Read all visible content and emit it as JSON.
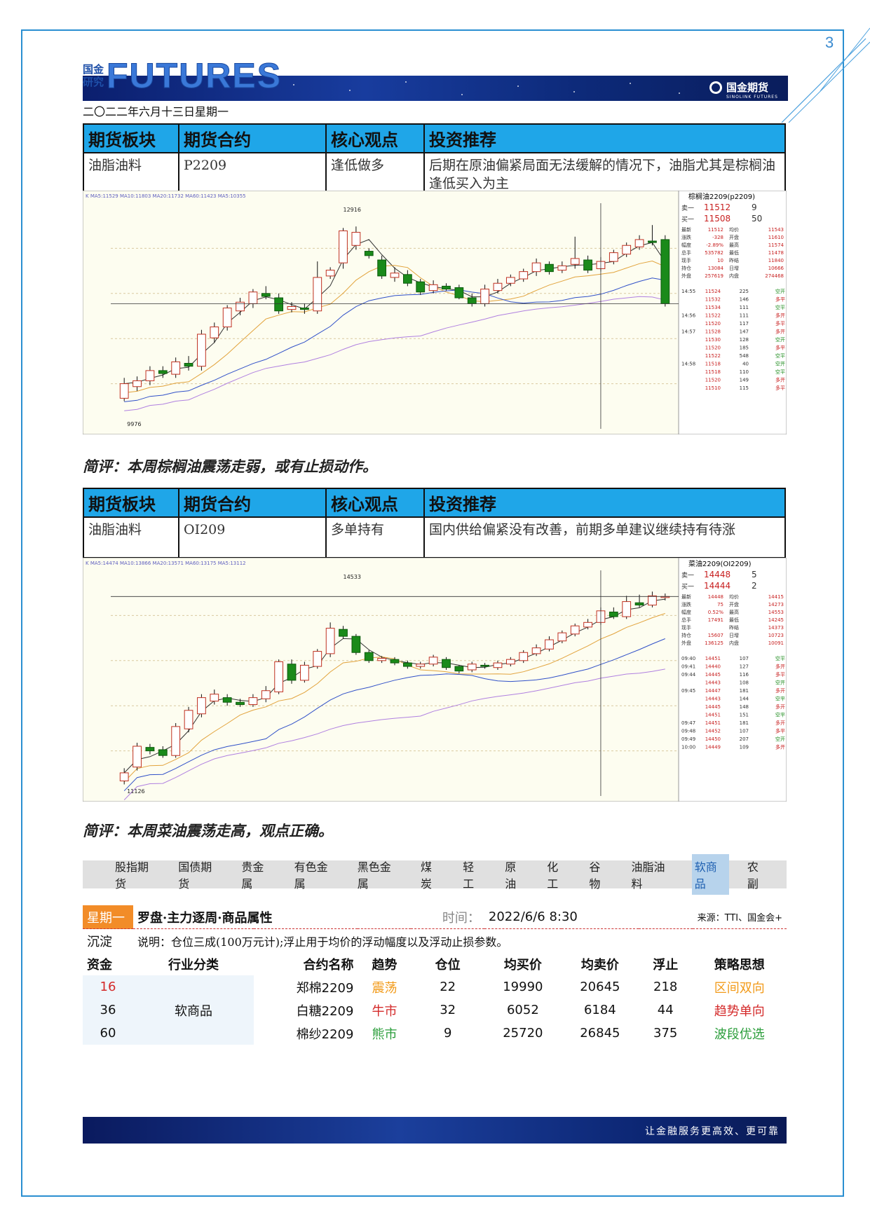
{
  "page_number": "3",
  "header": {
    "logo_cn_top": "国金",
    "logo_cn_bottom": "研究",
    "logo_en": "FUTURES",
    "brand_name": "国金期货",
    "brand_en": "SINOLINK FUTURES",
    "date": "二〇二二年六月十三日星期一"
  },
  "table_headers": [
    "期货板块",
    "期货合约",
    "核心观点",
    "投资推荐"
  ],
  "block1": {
    "sector": "油脂油料",
    "contract": "P2209",
    "view": "逢低做多",
    "recommendation": "后期在原油偏紧局面无法缓解的情况下，油脂尤其是棕榈油逢低买入为主",
    "comment": "简评：本周棕榈油震荡走弱，或有止损动作。"
  },
  "chart1": {
    "title": "棕榈油2209(p2209)",
    "ma_line": "K MA5:11529 MA10:11803 MA20:11732 MA60:11423 MA5:10355",
    "high_label": "12916",
    "low_label": "9976",
    "ask_label": "卖一",
    "ask_price": "11512",
    "ask_vol": "9",
    "bid_label": "买一",
    "bid_price": "11508",
    "bid_vol": "50",
    "stats": [
      [
        "最新",
        "11512",
        "均价",
        "11543"
      ],
      [
        "涨跌",
        "-328",
        "开盘",
        "11610"
      ],
      [
        "幅度",
        "-2.89%",
        "最高",
        "11574"
      ],
      [
        "总手",
        "535782",
        "最低",
        "11478"
      ],
      [
        "现手",
        "10",
        "昨结",
        "11840"
      ],
      [
        "持仓",
        "13084",
        "日增",
        "10666"
      ],
      [
        "外盘",
        "257619",
        "内盘",
        "274468"
      ]
    ],
    "ticks": [
      [
        "14:55",
        "11524",
        "225",
        "空开"
      ],
      [
        "",
        "11532",
        "146",
        "多平"
      ],
      [
        "",
        "11534",
        "111",
        "空平"
      ],
      [
        "14:56",
        "11522",
        "111",
        "多开"
      ],
      [
        "",
        "11520",
        "117",
        "多平"
      ],
      [
        "14:57",
        "11528",
        "147",
        "多开"
      ],
      [
        "",
        "11530",
        "128",
        "空开"
      ],
      [
        "",
        "11520",
        "185",
        "多平"
      ],
      [
        "",
        "11522",
        "548",
        "空平"
      ],
      [
        "14:58",
        "11518",
        "40",
        "空开"
      ],
      [
        "",
        "11518",
        "110",
        "空平"
      ],
      [
        "",
        "11520",
        "149",
        "多开"
      ],
      [
        "",
        "11510",
        "115",
        "多平"
      ]
    ]
  },
  "block2": {
    "sector": "油脂油料",
    "contract": "OI209",
    "view": "多单持有",
    "recommendation": "国内供给偏紧没有改善，前期多单建议继续持有待涨",
    "comment": "简评：本周菜油震荡走高，观点正确。"
  },
  "chart2": {
    "title": "菜油2209(OI2209)",
    "ma_line": "K MA5:14474 MA10:13866 MA20:13571 MA60:13175 MA5:13112",
    "high_label": "14533",
    "low_label": "11126",
    "ask_label": "卖一",
    "ask_price": "14448",
    "ask_vol": "5",
    "bid_label": "买一",
    "bid_price": "14444",
    "bid_vol": "2",
    "stats": [
      [
        "最新",
        "14448",
        "均价",
        "14415"
      ],
      [
        "涨跌",
        "75",
        "开盘",
        "14273"
      ],
      [
        "幅度",
        "0.52%",
        "最高",
        "14553"
      ],
      [
        "总手",
        "17491",
        "最低",
        "14245"
      ],
      [
        "现手",
        "",
        "昨结",
        "14373"
      ],
      [
        "持仓",
        "15607",
        "日增",
        "10723"
      ],
      [
        "外盘",
        "136125",
        "内盘",
        "10091"
      ]
    ],
    "ticks": [
      [
        "09:40",
        "14451",
        "107",
        "空平"
      ],
      [
        "09:41",
        "14440",
        "127",
        "多开"
      ],
      [
        "09:44",
        "14445",
        "116",
        "多平"
      ],
      [
        "",
        "14443",
        "108",
        "空开"
      ],
      [
        "09:45",
        "14447",
        "181",
        "多开"
      ],
      [
        "",
        "14443",
        "144",
        "空平"
      ],
      [
        "",
        "14445",
        "148",
        "多开"
      ],
      [
        "",
        "14451",
        "151",
        "空平"
      ],
      [
        "09:47",
        "14451",
        "181",
        "多开"
      ],
      [
        "09:48",
        "14452",
        "107",
        "多平"
      ],
      [
        "09:49",
        "14450",
        "207",
        "空开"
      ],
      [
        "10:00",
        "14449",
        "109",
        "多开"
      ]
    ]
  },
  "nav_tabs": [
    "股指期货",
    "国债期货",
    "贵金属",
    "有色金属",
    "黑色金属",
    "煤炭",
    "轻工",
    "原油",
    "化工",
    "谷物",
    "油脂油料",
    "软商品",
    "农副"
  ],
  "nav_active": "软商品",
  "positions": {
    "day": "星期一",
    "title": "罗盘·主力逐周·商品属性",
    "time_label": "时间：",
    "time_value": "2022/6/6 8:30",
    "source": "来源：TTI、国金会+",
    "left_labels": [
      "沉淀",
      "资金"
    ],
    "note": "说明：仓位三成(100万元计);浮止用于均价的浮动幅度以及浮动止损参数。",
    "columns": [
      "行业分类",
      "合约名称",
      "趋势",
      "仓位",
      "均买价",
      "均卖价",
      "浮止",
      "策略思想"
    ],
    "industry": "软商品",
    "rows": [
      {
        "fund": "16",
        "contract": "郑棉2209",
        "trend": "震荡",
        "position": "22",
        "buy": "19990",
        "sell": "20645",
        "float_stop": "218",
        "strategy": "区间双向"
      },
      {
        "fund": "36",
        "contract": "白糖2209",
        "trend": "牛市",
        "position": "32",
        "buy": "6052",
        "sell": "6184",
        "float_stop": "44",
        "strategy": "趋势单向"
      },
      {
        "fund": "60",
        "contract": "棉纱2209",
        "trend": "熊市",
        "position": "9",
        "buy": "25720",
        "sell": "26845",
        "float_stop": "375",
        "strategy": "波段优选"
      }
    ]
  },
  "footer_text": "让金融服务更高效、更可靠",
  "colors": {
    "frame": "#2a8fd1",
    "table_header": "#1fa6e8",
    "up_candle": "#1a8a1a",
    "red": "#d42a2a",
    "green": "#2a9d3a",
    "orange": "#f29a19"
  },
  "chart_data": [
    {
      "type": "candlestick",
      "title": "棕榈油2209(p2209)",
      "ylim": [
        9900,
        13000
      ],
      "candles": [
        [
          10320,
          10520,
          10280,
          10600
        ],
        [
          10480,
          10560,
          10420,
          10620
        ],
        [
          10560,
          10700,
          10500,
          10760
        ],
        [
          10700,
          10660,
          10600,
          10760
        ],
        [
          10650,
          10820,
          10600,
          10880
        ],
        [
          10800,
          10760,
          10700,
          10900
        ],
        [
          10760,
          11200,
          10700,
          11260
        ],
        [
          11150,
          11300,
          11080,
          11360
        ],
        [
          11300,
          11560,
          11250,
          11600
        ],
        [
          11520,
          11640,
          11460,
          11700
        ],
        [
          11620,
          11780,
          11560,
          11820
        ],
        [
          11760,
          11720,
          11680,
          11860
        ],
        [
          11700,
          11520,
          11480,
          11760
        ],
        [
          11540,
          11580,
          11500,
          11640
        ],
        [
          11560,
          11540,
          11480,
          11620
        ],
        [
          11520,
          11980,
          11480,
          12200
        ],
        [
          12000,
          12080,
          11960,
          12120
        ],
        [
          12180,
          12620,
          12100,
          12660
        ],
        [
          12420,
          12600,
          12360,
          12680
        ],
        [
          12340,
          12280,
          12240,
          12380
        ],
        [
          12220,
          12000,
          11960,
          12280
        ],
        [
          11980,
          12040,
          11920,
          12120
        ],
        [
          12020,
          11900,
          11860,
          12080
        ],
        [
          11920,
          11780,
          11740,
          11960
        ],
        [
          11800,
          11880,
          11760,
          11940
        ],
        [
          11860,
          11820,
          11800,
          11900
        ],
        [
          11840,
          11700,
          11680,
          11880
        ],
        [
          11700,
          11620,
          11580,
          11760
        ],
        [
          11620,
          11820,
          11580,
          11880
        ],
        [
          11800,
          11900,
          11760,
          11960
        ],
        [
          11900,
          11980,
          11860,
          12020
        ],
        [
          11960,
          12060,
          11920,
          12100
        ],
        [
          12060,
          12180,
          12000,
          12240
        ],
        [
          12160,
          12060,
          12020,
          12200
        ],
        [
          12080,
          12140,
          12040,
          12200
        ],
        [
          12160,
          12240,
          12100,
          12540
        ],
        [
          12220,
          12080,
          12040,
          12280
        ],
        [
          12100,
          12200,
          12060,
          12260
        ],
        [
          12200,
          12320,
          12160,
          12360
        ],
        [
          12300,
          12420,
          12260,
          12460
        ],
        [
          12400,
          12500,
          12360,
          12560
        ],
        [
          12480,
          12460,
          12420,
          12700
        ],
        [
          12500,
          11620,
          11580,
          12560
        ]
      ]
    },
    {
      "type": "candlestick",
      "title": "菜油2209(OI2209)",
      "ylim": [
        11000,
        14900
      ],
      "candles": [
        [
          11260,
          11400,
          11200,
          11480
        ],
        [
          11500,
          11860,
          11440,
          11920
        ],
        [
          11840,
          11780,
          11720,
          11900
        ],
        [
          11800,
          11700,
          11660,
          11860
        ],
        [
          11700,
          12200,
          11660,
          12260
        ],
        [
          12160,
          12480,
          12100,
          12540
        ],
        [
          12420,
          12700,
          12360,
          12760
        ],
        [
          12640,
          12760,
          12580,
          12840
        ],
        [
          12700,
          12620,
          12560,
          12760
        ],
        [
          12620,
          12580,
          12540,
          12680
        ],
        [
          12580,
          12700,
          12540,
          12760
        ],
        [
          12680,
          12820,
          12620,
          12900
        ],
        [
          12800,
          13320,
          12760,
          13360
        ],
        [
          13280,
          13000,
          12940,
          13360
        ],
        [
          13000,
          13260,
          12960,
          13320
        ],
        [
          13240,
          13500,
          13200,
          13540
        ],
        [
          13460,
          13900,
          13400,
          14000
        ],
        [
          13880,
          13760,
          13720,
          13940
        ],
        [
          13760,
          13480,
          13440,
          13800
        ],
        [
          13480,
          13340,
          13300,
          13520
        ],
        [
          13340,
          13380,
          13300,
          13420
        ],
        [
          13360,
          13300,
          13260,
          13400
        ],
        [
          13300,
          13240,
          13200,
          13340
        ],
        [
          13240,
          13280,
          13200,
          13320
        ],
        [
          13280,
          13400,
          13240,
          13440
        ],
        [
          13360,
          13220,
          13180,
          13400
        ],
        [
          13240,
          13160,
          13120,
          13260
        ],
        [
          13180,
          13280,
          13140,
          13320
        ],
        [
          13260,
          13240,
          13200,
          13300
        ],
        [
          13220,
          13300,
          13180,
          13340
        ],
        [
          13280,
          13360,
          13240,
          13400
        ],
        [
          13340,
          13480,
          13300,
          13520
        ],
        [
          13460,
          13560,
          13420,
          13620
        ],
        [
          13540,
          13700,
          13500,
          13760
        ],
        [
          13680,
          13820,
          13640,
          13860
        ],
        [
          13800,
          13940,
          13760,
          13980
        ],
        [
          13920,
          14000,
          13880,
          14060
        ],
        [
          14000,
          14200,
          13960,
          14260
        ],
        [
          14180,
          14100,
          14060,
          14260
        ],
        [
          14100,
          14360,
          14060,
          14460
        ],
        [
          14340,
          14300,
          14260,
          14480
        ],
        [
          14300,
          14460,
          14260,
          14533
        ],
        [
          14440,
          14448,
          14380,
          14500
        ]
      ]
    }
  ]
}
